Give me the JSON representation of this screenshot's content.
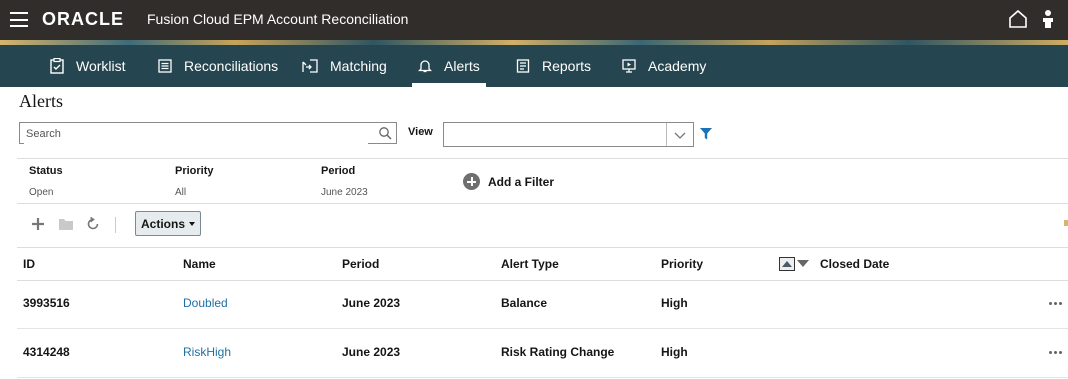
{
  "header": {
    "logo": "ORACLE",
    "app_title": "Fusion Cloud EPM Account Reconciliation"
  },
  "nav": {
    "items": [
      {
        "label": "Worklist",
        "icon": "clipboard-check-icon",
        "active": false
      },
      {
        "label": "Reconciliations",
        "icon": "list-icon",
        "active": false
      },
      {
        "label": "Matching",
        "icon": "match-arrows-icon",
        "active": false
      },
      {
        "label": "Alerts",
        "icon": "bell-icon",
        "active": true
      },
      {
        "label": "Reports",
        "icon": "report-icon",
        "active": false
      },
      {
        "label": "Academy",
        "icon": "play-video-icon",
        "active": false
      }
    ]
  },
  "page": {
    "title": "Alerts"
  },
  "search": {
    "placeholder": "Search",
    "value": ""
  },
  "view": {
    "label": "View",
    "selected": ""
  },
  "filters": {
    "items": [
      {
        "label": "Status",
        "value": "Open"
      },
      {
        "label": "Priority",
        "value": "All"
      },
      {
        "label": "Period",
        "value": "June 2023"
      }
    ],
    "add_label": "Add a Filter"
  },
  "toolbar": {
    "actions_label": "Actions"
  },
  "table": {
    "columns": [
      "ID",
      "Name",
      "Period",
      "Alert Type",
      "Priority",
      "Closed Date"
    ],
    "rows": [
      {
        "id": "3993516",
        "name": "Doubled",
        "period": "June 2023",
        "alert_type": "Balance",
        "priority": "High",
        "closed_date": ""
      },
      {
        "id": "4314248",
        "name": "RiskHigh",
        "period": "June 2023",
        "alert_type": "Risk Rating Change",
        "priority": "High",
        "closed_date": ""
      }
    ]
  },
  "colors": {
    "topbar": "#312d2a",
    "nav": "#254650",
    "link": "#1f6fa5",
    "filter_icon": "#1a73b8"
  }
}
